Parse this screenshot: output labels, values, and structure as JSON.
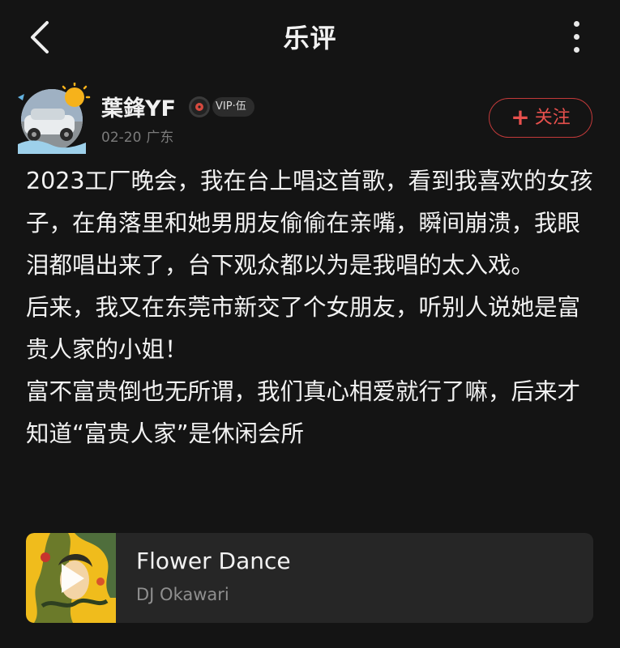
{
  "header": {
    "title": "乐评",
    "back_icon": "chevron-left-icon",
    "more_icon": "more-vertical-icon"
  },
  "post": {
    "author_name": "葉鋒YF",
    "vip_label": "VIP·伍",
    "date": "02-20",
    "location": "广东",
    "follow_label": "关注",
    "follow_icon": "plus-icon",
    "paragraphs": [
      "2023工厂晚会，我在台上唱这首歌，看到我喜欢的女孩子，在角落里和她男朋友偷偷在亲嘴，瞬间崩溃，我眼泪都唱出来了，台下观众都以为是我唱的太入戏。",
      "后来，我又在东莞市新交了个女朋友，听别人说她是富贵人家的小姐！",
      "富不富贵倒也无所谓，我们真心相爱就行了嘛，后来才知道“富贵人家”是休闲会所"
    ]
  },
  "song": {
    "title": "Flower Dance",
    "artist": "DJ Okawari",
    "play_icon": "play-icon"
  },
  "colors": {
    "background": "#141414",
    "accent_red": "#e7504d",
    "card_background": "#262626",
    "secondary_text": "#7b7b7b"
  }
}
